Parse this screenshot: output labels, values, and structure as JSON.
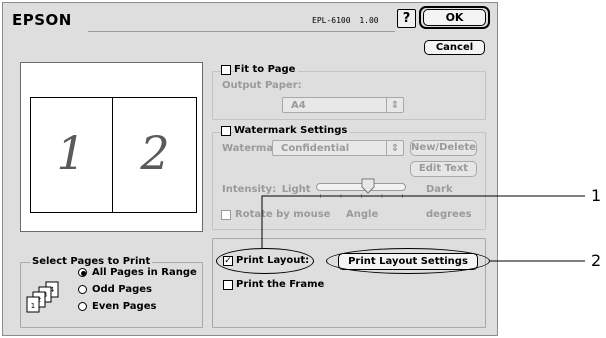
{
  "header": {
    "brand": "EPSON",
    "model": "EPL-6100",
    "version": "1.00",
    "help": "?",
    "ok": "OK",
    "cancel": "Cancel"
  },
  "preview": {
    "page1": "1",
    "page2": "2"
  },
  "pages_group": {
    "title": "Select Pages to Print",
    "options": [
      "All Pages in Range",
      "Odd Pages",
      "Even Pages"
    ],
    "selected": "All Pages in Range",
    "icon": "page-stack-icon"
  },
  "fit_to_page": {
    "label": "Fit to Page",
    "checked": false,
    "output_label": "Output Paper:",
    "paper": "A4"
  },
  "watermark": {
    "label": "Watermark Settings",
    "checked": false,
    "name_label": "Waterma",
    "name_value": "Confidential",
    "new_delete": "New/Delete",
    "edit_text": "Edit Text",
    "intensity_label": "Intensity:",
    "light": "Light",
    "dark": "Dark",
    "rotate_label": "Rotate by mouse",
    "angle_label": "Angle",
    "degrees_label": "degrees"
  },
  "print_layout": {
    "label": "Print Layout:",
    "checked": true,
    "settings_button": "Print Layout Settings"
  },
  "print_frame": {
    "label": "Print the Frame",
    "checked": false
  },
  "callouts": [
    "1",
    "2"
  ],
  "glyphs": {
    "check": "✓",
    "updown": "⇕"
  }
}
